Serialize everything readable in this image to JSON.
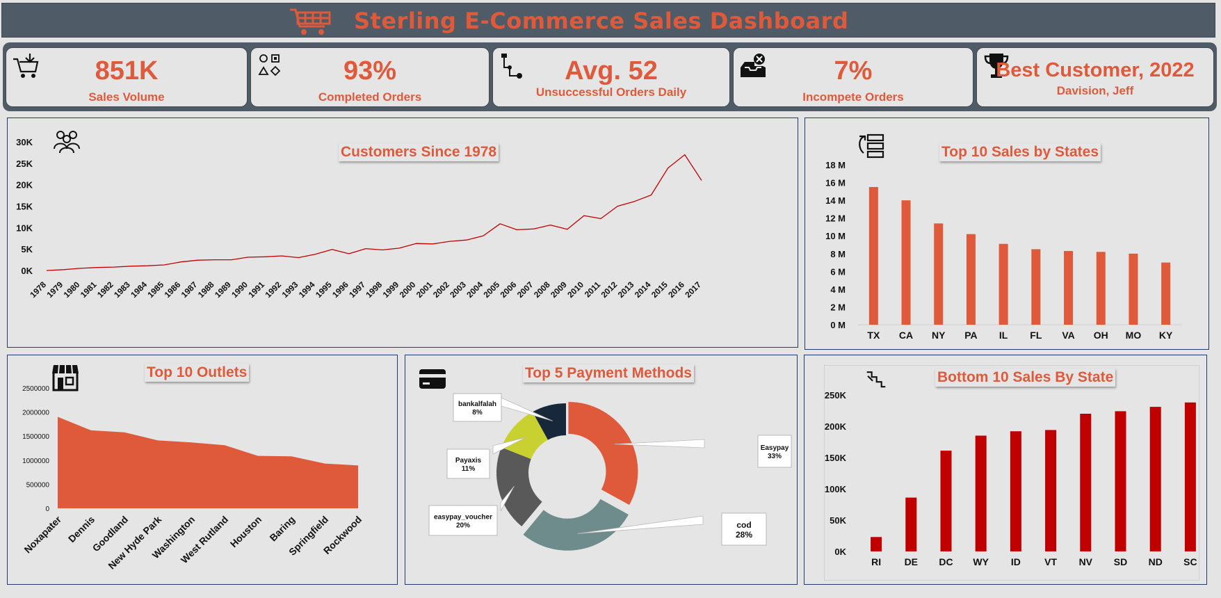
{
  "header": {
    "title": "Sterling E-Commerce Sales Dashboard",
    "icon": "shopping-cart-icon"
  },
  "kpis": [
    {
      "value": "851K",
      "label": "Sales Volume",
      "icon": "cart-arrow-icon"
    },
    {
      "value": "93%",
      "label": "Completed Orders",
      "icon": "shapes-icon"
    },
    {
      "value": "Avg. 52",
      "label": "Unsuccessful Orders Daily",
      "icon": "flow-icon"
    },
    {
      "value": "7%",
      "label": "Incompete Orders",
      "icon": "inbox-error-icon"
    },
    {
      "value": "Best Customer, 2022",
      "label": "Davision, Jeff",
      "icon": "trophy-icon"
    }
  ],
  "colors": {
    "accent": "#de5a3b",
    "header": "#4f5b66",
    "line": "#c00000",
    "bottom_bars": "#c00000"
  },
  "chart_data": [
    {
      "type": "line",
      "title": "Customers Since 1978",
      "x": [
        "1978",
        "1979",
        "1980",
        "1981",
        "1982",
        "1983",
        "1984",
        "1985",
        "1986",
        "1987",
        "1988",
        "1989",
        "1990",
        "1991",
        "1992",
        "1993",
        "1994",
        "1995",
        "1996",
        "1997",
        "1998",
        "1999",
        "2000",
        "2001",
        "2002",
        "2003",
        "2004",
        "2005",
        "2006",
        "2007",
        "2008",
        "2009",
        "2010",
        "2011",
        "2012",
        "2013",
        "2014",
        "2015",
        "2016",
        "2017"
      ],
      "y": [
        0,
        200,
        500,
        700,
        800,
        1000,
        1100,
        1300,
        2000,
        2400,
        2500,
        2500,
        3100,
        3200,
        3400,
        3000,
        3800,
        4900,
        3900,
        5100,
        4800,
        5200,
        6300,
        6200,
        6800,
        7100,
        8100,
        10900,
        9500,
        9700,
        10600,
        9600,
        12800,
        12100,
        15000,
        16100,
        17600,
        23900,
        27000,
        21000
      ],
      "yticks": [
        "0K",
        "5K",
        "10K",
        "15K",
        "20K",
        "25K",
        "30K"
      ],
      "ylim": [
        0,
        30000
      ]
    },
    {
      "type": "bar",
      "title": "Top 10 Sales by States",
      "categories": [
        "TX",
        "CA",
        "NY",
        "PA",
        "IL",
        "FL",
        "VA",
        "OH",
        "MO",
        "KY"
      ],
      "values": [
        15.5,
        14,
        11.4,
        10.2,
        9.1,
        8.5,
        8.3,
        8.2,
        8.0,
        7.0
      ],
      "unit": "M",
      "yticks": [
        "0 M",
        "2 M",
        "4 M",
        "6 M",
        "8 M",
        "10 M",
        "12 M",
        "14 M",
        "16 M",
        "18 M"
      ],
      "ylim": [
        0,
        18
      ]
    },
    {
      "type": "area",
      "title": "Top 10 Outlets",
      "categories": [
        "Noxapater",
        "Dennis",
        "Goodland",
        "New Hyde Park",
        "Washington",
        "West Rutland",
        "Houston",
        "Baring",
        "Springfield",
        "Rockwood"
      ],
      "values": [
        1900000,
        1620000,
        1580000,
        1410000,
        1370000,
        1310000,
        1090000,
        1080000,
        930000,
        890000
      ],
      "yticks": [
        "0",
        "500000",
        "1000000",
        "1500000",
        "2000000",
        "2500000"
      ],
      "ylim": [
        0,
        2500000
      ]
    },
    {
      "type": "pie",
      "title": "Top 5 Payment Methods",
      "labels": [
        "Easypay",
        "cod",
        "easypay_voucher",
        "Payaxis",
        "bankalfalah"
      ],
      "values": [
        33,
        28,
        20,
        11,
        8
      ],
      "percent_labels": [
        "33%",
        "28%",
        "20%",
        "11%",
        "8%"
      ],
      "colors": [
        "#de5a3b",
        "#6e8c8c",
        "#595959",
        "#c9d130",
        "#17283a"
      ]
    },
    {
      "type": "bar",
      "title": "Bottom 10 Sales By State",
      "categories": [
        "RI",
        "DE",
        "DC",
        "WY",
        "ID",
        "VT",
        "NV",
        "SD",
        "ND",
        "SC"
      ],
      "values": [
        23000,
        86000,
        161000,
        185000,
        192000,
        194000,
        220000,
        224000,
        231000,
        238000
      ],
      "yticks": [
        "0K",
        "50K",
        "100K",
        "150K",
        "200K",
        "250K"
      ],
      "ylim": [
        0,
        250000
      ]
    }
  ]
}
